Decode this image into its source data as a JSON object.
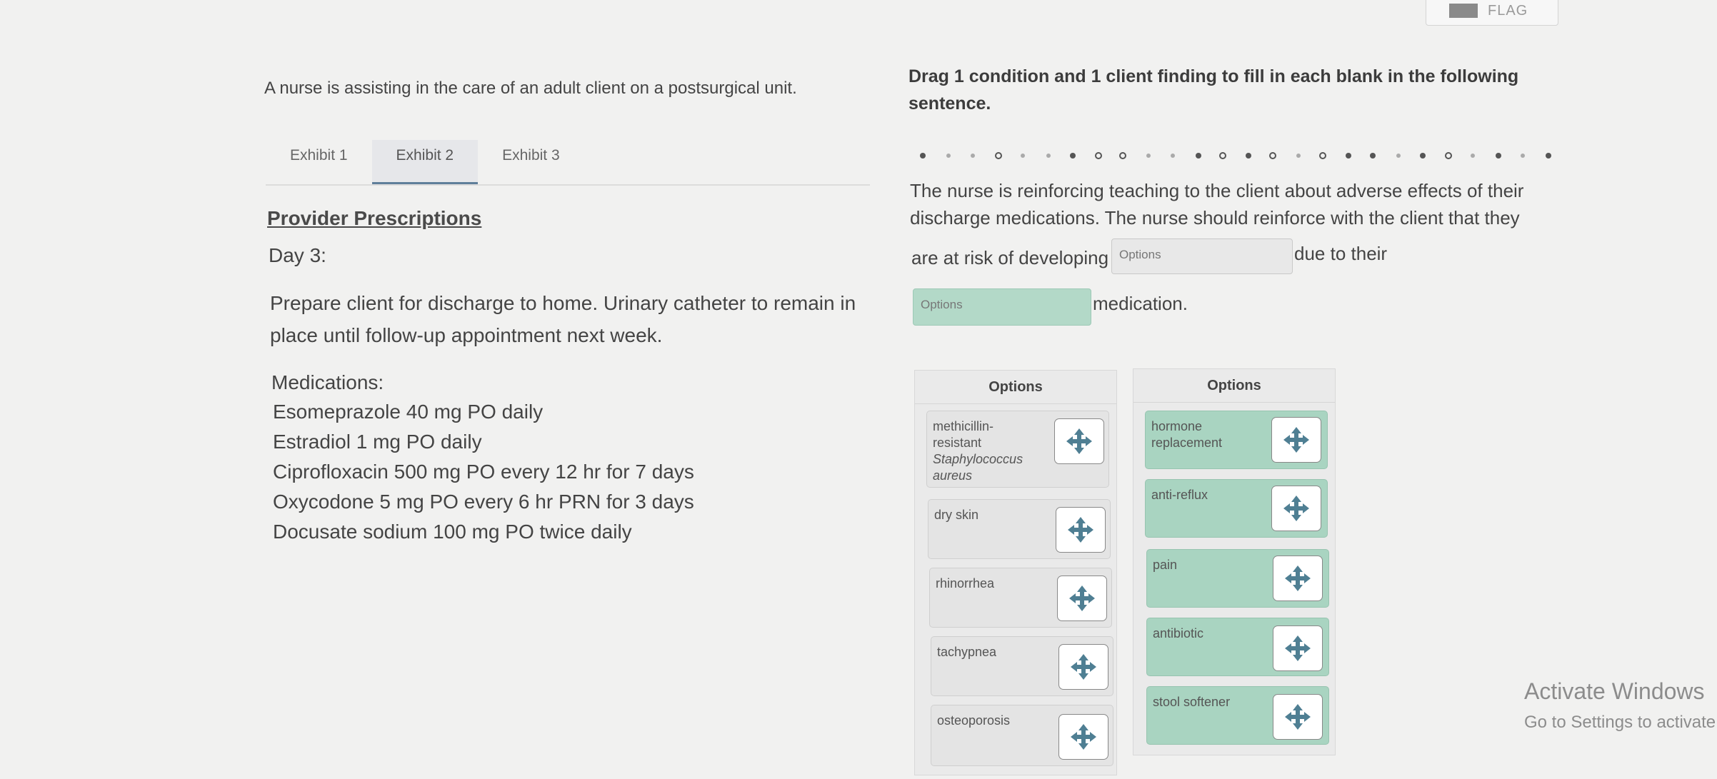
{
  "header": {
    "flag_label": "FLAG"
  },
  "intro": "A nurse is assisting in the care of an adult client on a postsurgical unit.",
  "tabs": [
    {
      "label": "Exhibit 1"
    },
    {
      "label": "Exhibit 2"
    },
    {
      "label": "Exhibit 3"
    }
  ],
  "exhibit": {
    "title": "Provider Prescriptions",
    "day": "Day 3:",
    "instructions": "Prepare client for discharge to home. Urinary catheter to remain in place until follow-up appointment next week.",
    "medications_label": "Medications:",
    "medications": [
      "Esomeprazole 40 mg PO daily",
      "Estradiol 1 mg PO daily",
      "Ciprofloxacin 500 mg PO every 12 hr for 7 days",
      "Oxycodone 5 mg PO every 6 hr PRN for 3 days",
      "Docusate sodium 100 mg PO twice daily"
    ]
  },
  "question": {
    "instruction": "Drag 1 condition and 1 client finding to fill in each blank in the following sentence.",
    "sentence_line1": "The nurse is reinforcing teaching to the client about adverse effects of their",
    "sentence_line2": "discharge medications. The nurse should reinforce with the client that they",
    "sentence_part3": "are at risk of developing",
    "sentence_part4": "due to their",
    "sentence_part5": "medication.",
    "blank1_placeholder": "Options",
    "blank2_placeholder": "Options"
  },
  "options_left": {
    "header": "Options",
    "items": [
      {
        "line1": "methicillin-",
        "line2": "resistant",
        "line3": "Staphylococcus",
        "line4": "aureus"
      },
      {
        "label": "dry skin"
      },
      {
        "label": "rhinorrhea"
      },
      {
        "label": "tachypnea"
      },
      {
        "label": "osteoporosis"
      }
    ]
  },
  "options_right": {
    "header": "Options",
    "items": [
      {
        "line1": "hormone",
        "line2": "replacement"
      },
      {
        "label": "anti-reflux"
      },
      {
        "label": "pain"
      },
      {
        "label": "antibiotic"
      },
      {
        "label": "stool softener"
      }
    ]
  },
  "watermark": {
    "line1": "Activate Windows",
    "line2": "Go to Settings to activate Windows."
  },
  "colors": {
    "accent_green": "#a9d4c1",
    "tab_underline": "#5f7f9a",
    "move_icon": "#4f7f93"
  }
}
